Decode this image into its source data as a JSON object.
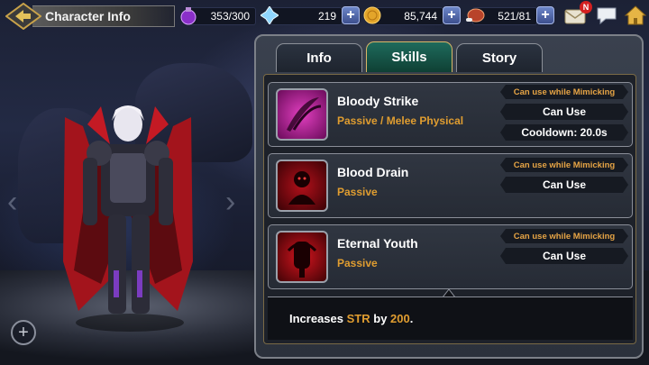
{
  "header": {
    "title": "Character Info"
  },
  "resources": [
    {
      "icon": "stamina-potion-icon",
      "value": "353/300"
    },
    {
      "icon": "crystal-icon",
      "value": "219"
    },
    {
      "icon": "gold-coin-icon",
      "value": "85,744"
    },
    {
      "icon": "meat-icon",
      "value": "521/81"
    }
  ],
  "notifications": {
    "mail_badge": "N"
  },
  "tabs": [
    {
      "label": "Info",
      "active": false
    },
    {
      "label": "Skills",
      "active": true
    },
    {
      "label": "Story",
      "active": false
    }
  ],
  "skills": [
    {
      "name": "Bloody Strike",
      "type": "Passive / Melee Physical",
      "mimic": "Can use while Mimicking",
      "use": "Can Use",
      "cooldown": "Cooldown: 20.0s",
      "icon": "claw-strike-icon"
    },
    {
      "name": "Blood Drain",
      "type": "Passive",
      "mimic": "Can use while Mimicking",
      "use": "Can Use",
      "icon": "blood-drain-icon"
    },
    {
      "name": "Eternal Youth",
      "type": "Passive",
      "mimic": "Can use while Mimicking",
      "use": "Can Use",
      "icon": "eternal-youth-icon"
    }
  ],
  "description": {
    "prefix": "Increases ",
    "stat": "STR",
    "middle": " by ",
    "amount": "200",
    "suffix": "."
  },
  "colors": {
    "accent": "#e09d30",
    "active_tab": "#1e6a5c",
    "gold_border": "#d9b668"
  }
}
